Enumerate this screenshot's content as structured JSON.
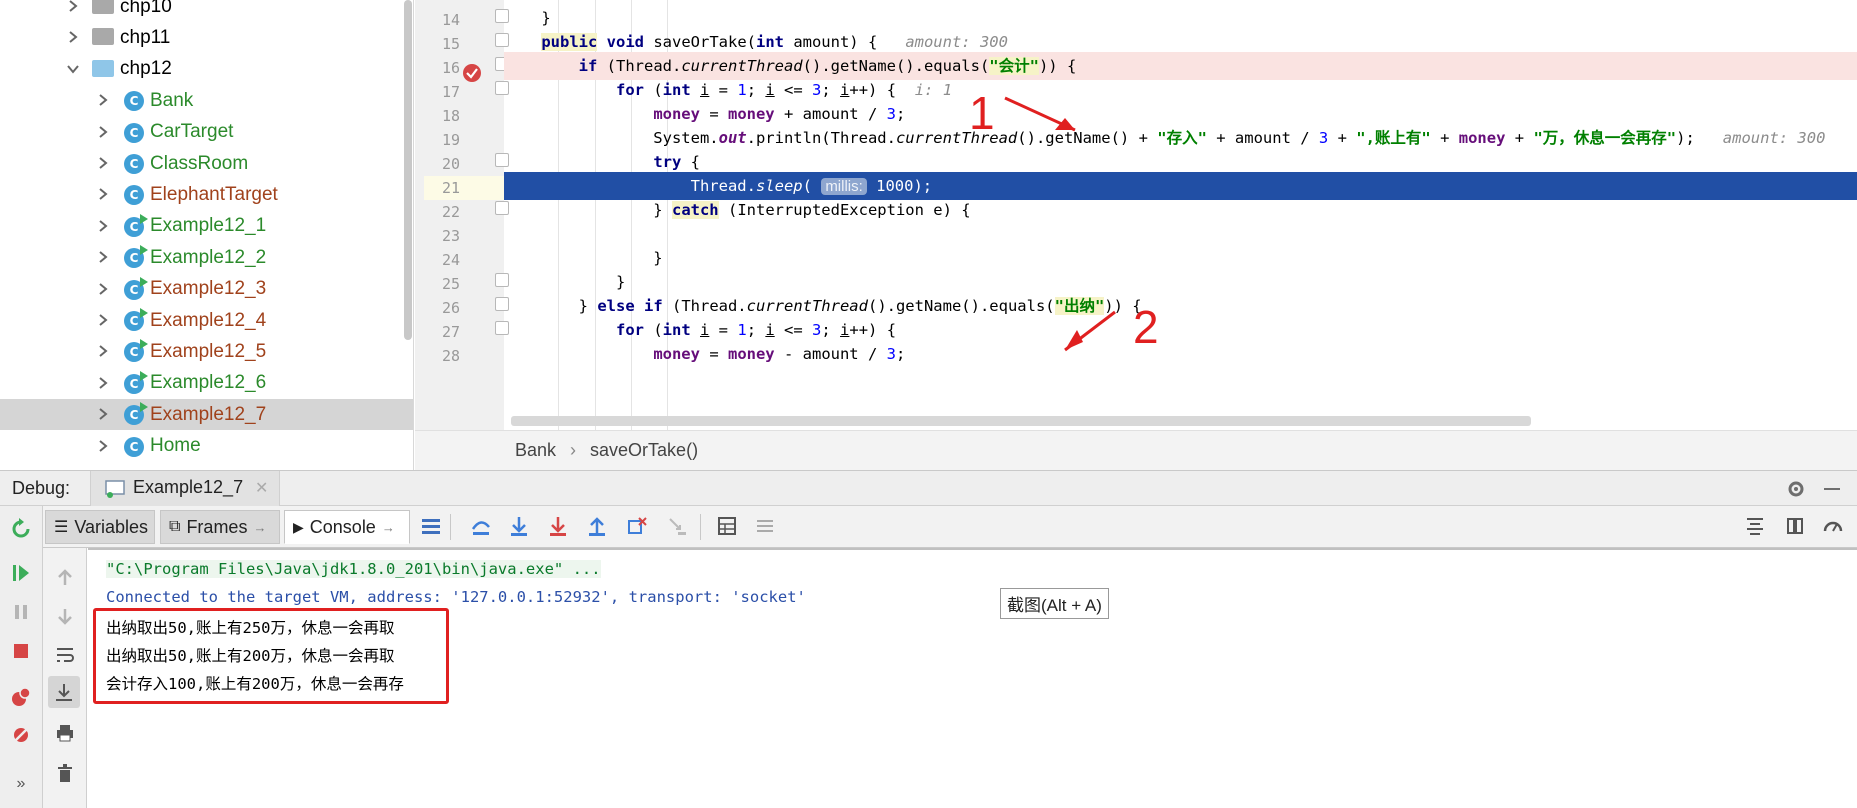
{
  "project_tree": {
    "items": [
      {
        "label": "chp10",
        "kind": "folder",
        "state": "collapsed",
        "color": "#000000"
      },
      {
        "label": "chp11",
        "kind": "folder",
        "state": "collapsed",
        "color": "#000000"
      },
      {
        "label": "chp12",
        "kind": "folder",
        "state": "expanded",
        "color": "#000000"
      },
      {
        "label": "Bank",
        "kind": "class",
        "state": "collapsed",
        "color": "#2b8a2b"
      },
      {
        "label": "CarTarget",
        "kind": "class",
        "state": "collapsed",
        "color": "#2b8a2b"
      },
      {
        "label": "ClassRoom",
        "kind": "class",
        "state": "collapsed",
        "color": "#2b8a2b"
      },
      {
        "label": "ElephantTarget",
        "kind": "class",
        "state": "collapsed",
        "color": "#a0421c"
      },
      {
        "label": "Example12_1",
        "kind": "runnable",
        "state": "collapsed",
        "color": "#2b8a2b"
      },
      {
        "label": "Example12_2",
        "kind": "runnable",
        "state": "collapsed",
        "color": "#2b8a2b"
      },
      {
        "label": "Example12_3",
        "kind": "runnable",
        "state": "collapsed",
        "color": "#a0421c"
      },
      {
        "label": "Example12_4",
        "kind": "runnable",
        "state": "collapsed",
        "color": "#a0421c"
      },
      {
        "label": "Example12_5",
        "kind": "runnable",
        "state": "collapsed",
        "color": "#a0421c"
      },
      {
        "label": "Example12_6",
        "kind": "runnable",
        "state": "collapsed",
        "color": "#2b8a2b"
      },
      {
        "label": "Example12_7",
        "kind": "runnable",
        "state": "collapsed",
        "color": "#a0421c",
        "selected": true
      },
      {
        "label": "Home",
        "kind": "class",
        "state": "collapsed",
        "color": "#2b8a2b"
      }
    ]
  },
  "editor": {
    "line_numbers": [
      "14",
      "15",
      "16",
      "17",
      "18",
      "19",
      "20",
      "21",
      "22",
      "23",
      "24",
      "25",
      "26",
      "27",
      "28"
    ],
    "annotations": {
      "arrow_1": "1",
      "arrow_2": "2"
    }
  },
  "breadcrumb": {
    "items": [
      "Bank",
      "saveOrTake()"
    ]
  },
  "debug": {
    "label": "Debug:",
    "config_tab": "Example12_7",
    "tabs": {
      "variables": "Variables",
      "frames": "Frames",
      "console": "Console"
    }
  },
  "console": {
    "lines": [
      {
        "text": "\"C:\\Program Files\\Java\\jdk1.8.0_201\\bin\\java.exe\" ...",
        "color": "#0a7a2b"
      },
      {
        "text": "Connected to the target VM, address: '127.0.0.1:52932', transport: 'socket'",
        "color": "#2b4fa8"
      },
      {
        "text": "出纳取出50,账上有250万，休息一会再取",
        "color": "#000000"
      },
      {
        "text": "出纳取出50,账上有200万，休息一会再取",
        "color": "#000000"
      },
      {
        "text": "会计存入100,账上有200万，休息一会再存",
        "color": "#000000"
      }
    ],
    "tooltip": "截图(Alt + A)"
  },
  "colors": {
    "accent": "#214fa5",
    "annotation_red": "#e02020",
    "breakpoint": "#d64545"
  }
}
